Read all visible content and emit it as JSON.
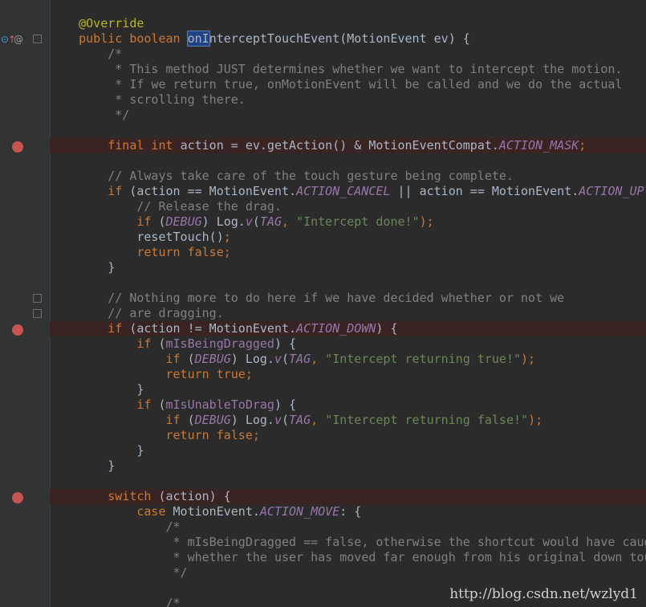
{
  "editor": {
    "watermark": "http://blog.csdn.net/wzlyd1",
    "lines": [
      [
        {
          "t": "    "
        },
        {
          "t": "@Override",
          "c": "ann"
        }
      ],
      [
        {
          "t": "    "
        },
        {
          "t": "public boolean ",
          "c": "kw"
        },
        {
          "t": "onI",
          "c": "sel"
        },
        {
          "t": "nterceptTouchEvent(MotionEvent ev) {"
        }
      ],
      [
        {
          "t": "        "
        },
        {
          "t": "/*",
          "c": "cmt"
        }
      ],
      [
        {
          "t": "         "
        },
        {
          "t": "* This method JUST determines whether we want to intercept the motion.",
          "c": "cmt"
        }
      ],
      [
        {
          "t": "         "
        },
        {
          "t": "* If we return true, onMotionEvent will be called and we do the actual",
          "c": "cmt"
        }
      ],
      [
        {
          "t": "         "
        },
        {
          "t": "* scrolling there.",
          "c": "cmt"
        }
      ],
      [
        {
          "t": "         "
        },
        {
          "t": "*/",
          "c": "cmt"
        }
      ],
      [],
      [
        {
          "t": "        "
        },
        {
          "t": "final int ",
          "c": "kw"
        },
        {
          "t": "action = ev.getAction() & MotionEventCompat."
        },
        {
          "t": "ACTION_MASK",
          "c": "cst"
        },
        {
          "t": ";",
          "c": "kw"
        }
      ],
      [],
      [
        {
          "t": "        "
        },
        {
          "t": "// Always take care of the touch gesture being complete.",
          "c": "cmt"
        }
      ],
      [
        {
          "t": "        "
        },
        {
          "t": "if ",
          "c": "kw"
        },
        {
          "t": "(action == MotionEvent."
        },
        {
          "t": "ACTION_CANCEL",
          "c": "cst"
        },
        {
          "t": " || action == MotionEvent."
        },
        {
          "t": "ACTION_UP",
          "c": "cst"
        },
        {
          "t": ") {"
        }
      ],
      [
        {
          "t": "            "
        },
        {
          "t": "// Release the drag.",
          "c": "cmt"
        }
      ],
      [
        {
          "t": "            "
        },
        {
          "t": "if ",
          "c": "kw"
        },
        {
          "t": "("
        },
        {
          "t": "DEBUG",
          "c": "cst"
        },
        {
          "t": ") Log."
        },
        {
          "t": "v",
          "c": "cst"
        },
        {
          "t": "("
        },
        {
          "t": "TAG",
          "c": "cst"
        },
        {
          "t": ", ",
          "c": "kw"
        },
        {
          "t": "\"Intercept done!\"",
          "c": "str"
        },
        {
          "t": ");",
          "c": "kw"
        }
      ],
      [
        {
          "t": "            "
        },
        {
          "t": "resetTouch()"
        },
        {
          "t": ";",
          "c": "kw"
        }
      ],
      [
        {
          "t": "            "
        },
        {
          "t": "return false;",
          "c": "kw"
        }
      ],
      [
        {
          "t": "        }"
        }
      ],
      [],
      [
        {
          "t": "        "
        },
        {
          "t": "// Nothing more to do here if we have decided whether or not we",
          "c": "cmt"
        }
      ],
      [
        {
          "t": "        "
        },
        {
          "t": "// are dragging.",
          "c": "cmt"
        }
      ],
      [
        {
          "t": "        "
        },
        {
          "t": "if ",
          "c": "kw"
        },
        {
          "t": "(action != MotionEvent."
        },
        {
          "t": "ACTION_DOWN",
          "c": "cst"
        },
        {
          "t": ") {"
        }
      ],
      [
        {
          "t": "            "
        },
        {
          "t": "if ",
          "c": "kw"
        },
        {
          "t": "("
        },
        {
          "t": "mIsBeingDragged",
          "c": "fld"
        },
        {
          "t": ") {"
        }
      ],
      [
        {
          "t": "                "
        },
        {
          "t": "if ",
          "c": "kw"
        },
        {
          "t": "("
        },
        {
          "t": "DEBUG",
          "c": "cst"
        },
        {
          "t": ") Log."
        },
        {
          "t": "v",
          "c": "cst"
        },
        {
          "t": "("
        },
        {
          "t": "TAG",
          "c": "cst"
        },
        {
          "t": ", ",
          "c": "kw"
        },
        {
          "t": "\"Intercept returning true!\"",
          "c": "str"
        },
        {
          "t": ");",
          "c": "kw"
        }
      ],
      [
        {
          "t": "                "
        },
        {
          "t": "return true;",
          "c": "kw"
        }
      ],
      [
        {
          "t": "            }"
        }
      ],
      [
        {
          "t": "            "
        },
        {
          "t": "if ",
          "c": "kw"
        },
        {
          "t": "("
        },
        {
          "t": "mIsUnableToDrag",
          "c": "fld"
        },
        {
          "t": ") {"
        }
      ],
      [
        {
          "t": "                "
        },
        {
          "t": "if ",
          "c": "kw"
        },
        {
          "t": "("
        },
        {
          "t": "DEBUG",
          "c": "cst"
        },
        {
          "t": ") Log."
        },
        {
          "t": "v",
          "c": "cst"
        },
        {
          "t": "("
        },
        {
          "t": "TAG",
          "c": "cst"
        },
        {
          "t": ", ",
          "c": "kw"
        },
        {
          "t": "\"Intercept returning false!\"",
          "c": "str"
        },
        {
          "t": ");",
          "c": "kw"
        }
      ],
      [
        {
          "t": "                "
        },
        {
          "t": "return false;",
          "c": "kw"
        }
      ],
      [
        {
          "t": "            }"
        }
      ],
      [
        {
          "t": "        }"
        }
      ],
      [],
      [
        {
          "t": "        "
        },
        {
          "t": "switch ",
          "c": "kw"
        },
        {
          "t": "(action) {"
        }
      ],
      [
        {
          "t": "            "
        },
        {
          "t": "case ",
          "c": "kw"
        },
        {
          "t": "MotionEvent."
        },
        {
          "t": "ACTION_MOVE",
          "c": "cst"
        },
        {
          "t": ": {"
        }
      ],
      [
        {
          "t": "                "
        },
        {
          "t": "/*",
          "c": "cmt"
        }
      ],
      [
        {
          "t": "                 "
        },
        {
          "t": "* mIsBeingDragged == false, otherwise the shortcut would have caught it. Check",
          "c": "cmt"
        }
      ],
      [
        {
          "t": "                 "
        },
        {
          "t": "* whether the user has moved far enough from his original down touch.",
          "c": "cmt"
        }
      ],
      [
        {
          "t": "                 "
        },
        {
          "t": "*/",
          "c": "cmt"
        }
      ],
      [],
      [
        {
          "t": "                "
        },
        {
          "t": "/*",
          "c": "cmt"
        }
      ]
    ]
  }
}
